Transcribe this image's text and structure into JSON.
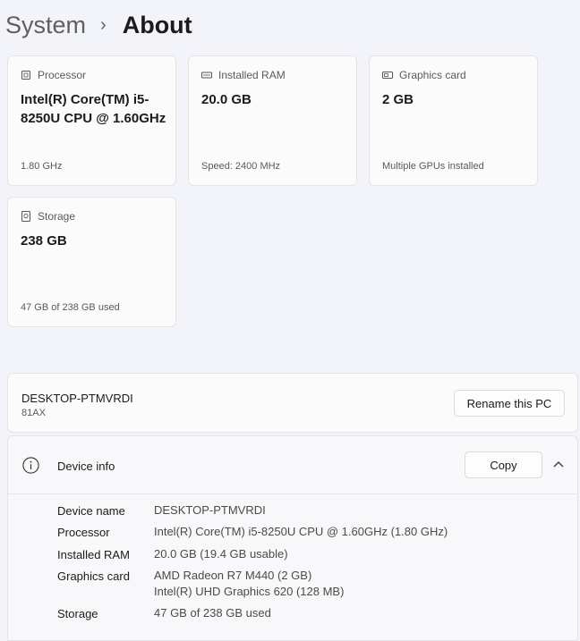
{
  "breadcrumb": {
    "parent": "System",
    "current": "About"
  },
  "cards": [
    {
      "label": "Processor",
      "value": "Intel(R) Core(TM) i5-8250U CPU @ 1.60GHz",
      "sub": "1.80 GHz",
      "icon": "processor-icon"
    },
    {
      "label": "Installed RAM",
      "value": "20.0 GB",
      "sub": "Speed: 2400 MHz",
      "icon": "ram-icon"
    },
    {
      "label": "Graphics card",
      "value": "2 GB",
      "sub": "Multiple GPUs installed",
      "icon": "graphics-card-icon"
    },
    {
      "label": "Storage",
      "value": "238 GB",
      "sub": "47 GB of 238 GB used",
      "icon": "storage-icon"
    }
  ],
  "pc": {
    "name": "DESKTOP-PTMVRDI",
    "model": "81AX",
    "rename_label": "Rename this PC"
  },
  "device_info": {
    "title": "Device info",
    "copy_label": "Copy",
    "specs": [
      {
        "key": "Device name",
        "value": "DESKTOP-PTMVRDI"
      },
      {
        "key": "Processor",
        "value": "Intel(R) Core(TM) i5-8250U CPU @ 1.60GHz (1.80 GHz)"
      },
      {
        "key": "Installed RAM",
        "value": "20.0 GB (19.4 GB usable)"
      },
      {
        "key": "Graphics card",
        "value": "AMD Radeon R7 M440 (2 GB)",
        "value2": "Intel(R) UHD Graphics 620 (128 MB)"
      },
      {
        "key": "Storage",
        "value": "47 GB of 238 GB used"
      }
    ]
  },
  "colors": {
    "background": "#f3f4f9",
    "card": "#fbfbfc",
    "text": "#1b1b1b",
    "secondary_text": "#5a5a5a"
  }
}
